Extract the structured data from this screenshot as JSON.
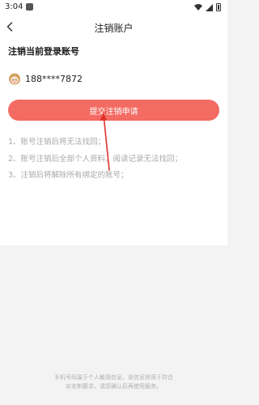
{
  "status_bar": {
    "time": "3:04",
    "app_icon": "app-notification-icon",
    "wifi_icon": "wifi-icon",
    "signal_icon": "signal-icon",
    "battery_icon": "battery-icon"
  },
  "nav": {
    "back_icon": "back-chevron-icon",
    "title": "注销账户"
  },
  "account": {
    "section_title": "注销当前登录账号",
    "avatar_icon": "avatar-icon",
    "phone": "188****7872"
  },
  "submit_label": "提交注销申请",
  "notices": [
    "1、账号注销后将无法找回；",
    "2、账号注销后全部个人资料、阅读记录无法找回；",
    "3、注销后将解除所有绑定的账号；"
  ],
  "footer": {
    "line1": "手机号码属于个人敏感信息，该信息将用于符合",
    "line2": "实名制要求，请您确认后再使用服务。"
  },
  "colors": {
    "accent": "#f36b62",
    "arrow": "#e0312b",
    "background": "#f3f3f3",
    "muted_text": "#a8a8a8"
  }
}
